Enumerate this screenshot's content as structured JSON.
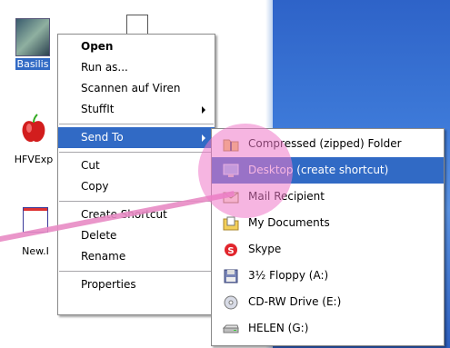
{
  "desktop": {
    "icons": [
      {
        "label": "Basilis",
        "selected": true
      },
      {
        "label": ""
      },
      {
        "label": "HFVExp"
      },
      {
        "label": "New.I"
      }
    ]
  },
  "context_menu": {
    "items": [
      {
        "label": "Open",
        "bold": true
      },
      {
        "label": "Run as..."
      },
      {
        "label": "Scannen auf Viren"
      },
      {
        "label": "StuffIt",
        "submenu": true
      },
      {
        "label": "Send To",
        "submenu": true,
        "highlighted": true
      },
      {
        "label": "Cut"
      },
      {
        "label": "Copy"
      },
      {
        "label": "Create Shortcut"
      },
      {
        "label": "Delete"
      },
      {
        "label": "Rename"
      },
      {
        "label": "Properties"
      }
    ]
  },
  "send_to_menu": {
    "items": [
      {
        "label": "Compressed (zipped) Folder",
        "icon": "zip-folder-icon"
      },
      {
        "label": "Desktop (create shortcut)",
        "icon": "desktop-icon",
        "highlighted": true
      },
      {
        "label": "Mail Recipient",
        "icon": "mail-icon"
      },
      {
        "label": "My Documents",
        "icon": "my-documents-icon"
      },
      {
        "label": "Skype",
        "icon": "skype-icon"
      },
      {
        "label": "3½ Floppy (A:)",
        "icon": "floppy-icon"
      },
      {
        "label": "CD-RW Drive (E:)",
        "icon": "cd-drive-icon"
      },
      {
        "label": "HELEN (G:)",
        "icon": "drive-icon"
      }
    ]
  },
  "colors": {
    "highlight": "#316ac5",
    "annotation_pink": "#e88bc4"
  }
}
